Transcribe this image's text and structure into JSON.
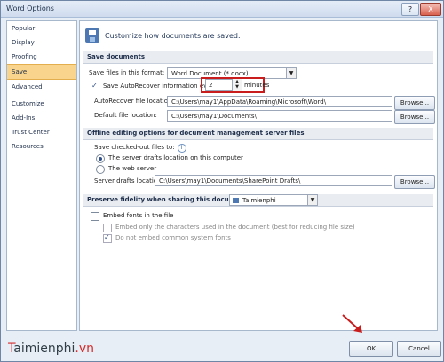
{
  "window": {
    "title": "Word Options",
    "help_label": "?",
    "close_label": "X"
  },
  "sidebar": {
    "items": [
      "Popular",
      "Display",
      "Proofing",
      "Save",
      "Advanced",
      "Customize",
      "Add-Ins",
      "Trust Center",
      "Resources"
    ],
    "active": "Save"
  },
  "header": {
    "text": "Customize how documents are saved."
  },
  "sections": {
    "save_documents": "Save documents",
    "offline": "Offline editing options for document management server files",
    "fidelity": "Preserve fidelity when sharing this document:"
  },
  "save": {
    "format_label": "Save files in this format:",
    "format_value": "Word Document (*.docx)",
    "autorecover_label": "Save AutoRecover information every",
    "autorecover_minutes": "2",
    "minutes_label": "minutes",
    "autorecover_location_label": "AutoRecover file location:",
    "autorecover_location_value": "C:\\Users\\may1\\AppData\\Roaming\\Microsoft\\Word\\",
    "default_location_label": "Default file location:",
    "default_location_value": "C:\\Users\\may1\\Documents\\",
    "browse_label": "Browse..."
  },
  "offline": {
    "checked_out_label": "Save checked-out files to:",
    "radio_drafts": "The server drafts location on this computer",
    "radio_web": "The web server",
    "drafts_location_label": "Server drafts location:",
    "drafts_location_value": "C:\\Users\\may1\\Documents\\SharePoint Drafts\\"
  },
  "fidelity": {
    "document": "Taimienphi",
    "embed_fonts": "Embed fonts in the file",
    "embed_only": "Embed only the characters used in the document (best for reducing file size)",
    "do_not_embed": "Do not embed common system fonts"
  },
  "footer": {
    "ok": "OK",
    "cancel": "Cancel"
  },
  "watermark": {
    "main": "aimienphi",
    "first": "T",
    "tld": ".vn"
  },
  "colors": {
    "highlight_box": "#c91c1c",
    "active_sidebar": "#f8d48c"
  }
}
